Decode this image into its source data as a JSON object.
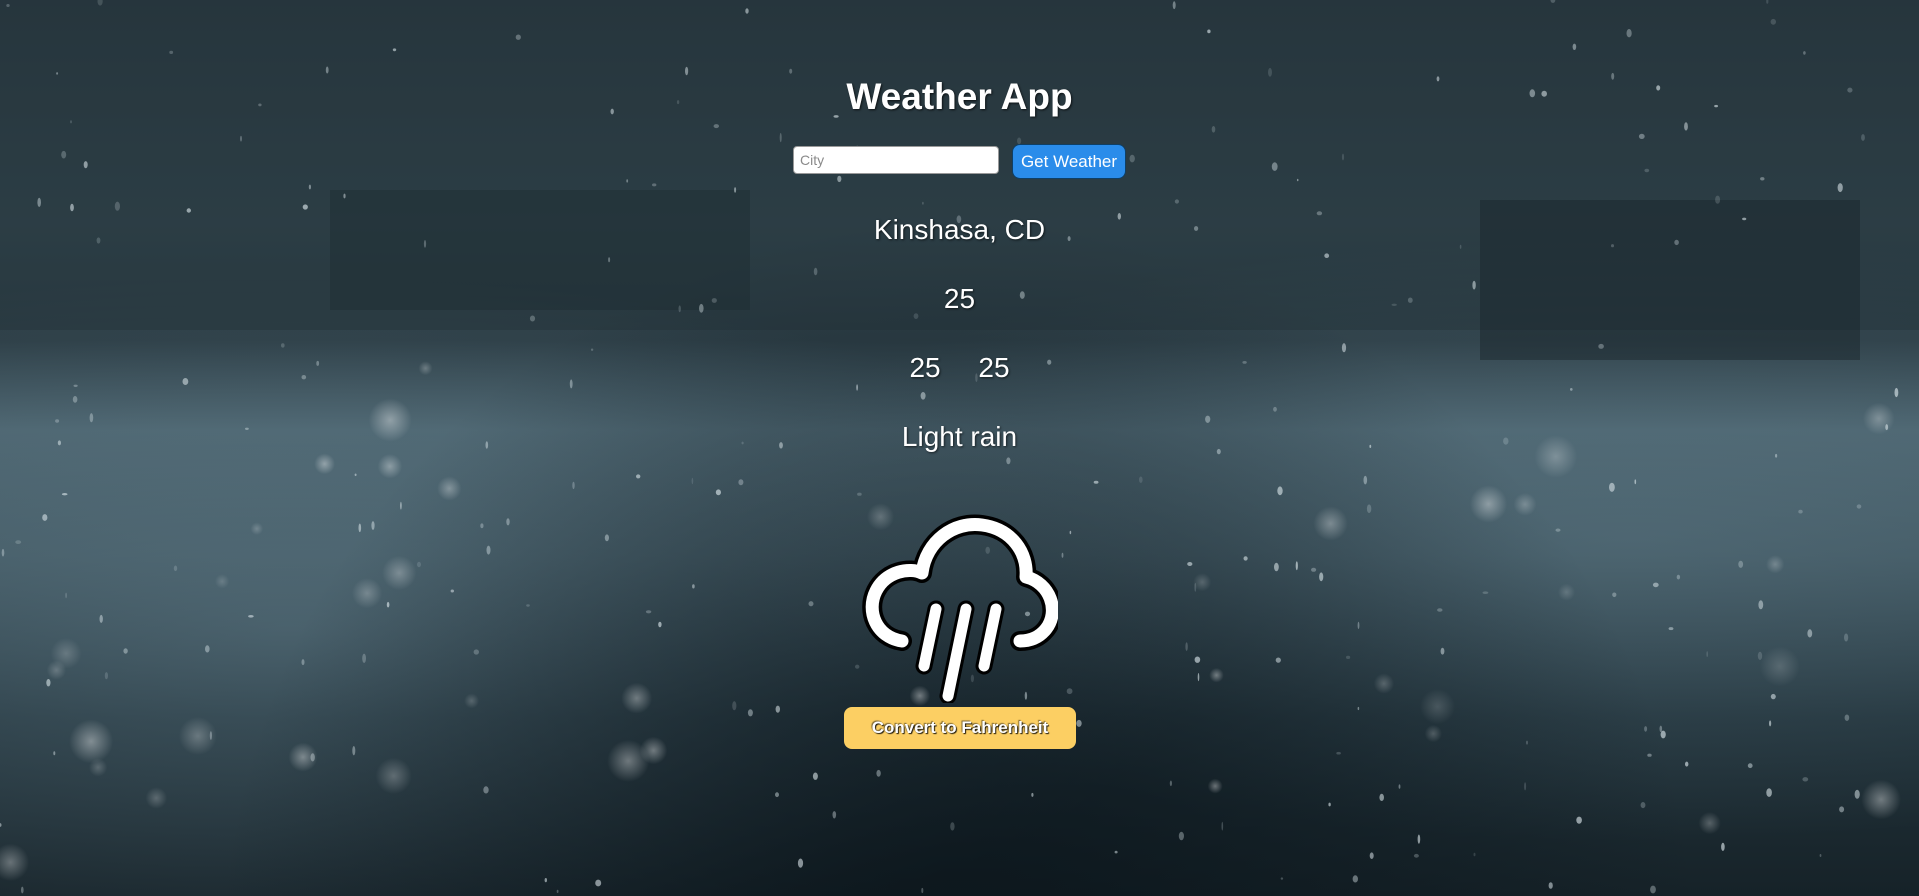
{
  "app": {
    "title": "Weather App"
  },
  "search": {
    "placeholder": "City",
    "value": "",
    "button_label": "Get Weather"
  },
  "weather": {
    "location": "Kinshasa, CD",
    "temperature": "25",
    "temp_min": "25",
    "temp_max": "25",
    "description": "Light rain",
    "icon": "rain-cloud-icon"
  },
  "actions": {
    "convert_label": "Convert to Fahrenheit"
  },
  "colors": {
    "get_button": "#2a8cea",
    "convert_button": "#fccf63",
    "text": "#ffffff"
  }
}
